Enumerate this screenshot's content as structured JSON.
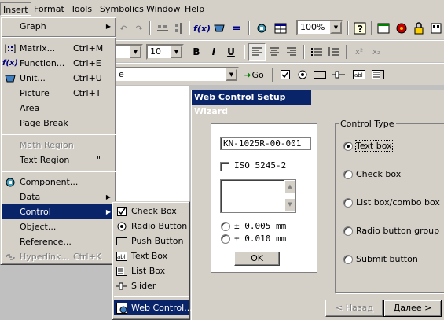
{
  "menubar": {
    "items": [
      "Insert",
      "Format",
      "Tools",
      "Symbolics",
      "Window",
      "Help"
    ]
  },
  "toolbar": {
    "zoom": "100%",
    "font_size": "10",
    "address_value": "e",
    "go_label": "Go"
  },
  "insert_menu": {
    "items": [
      {
        "label": "Graph",
        "shortcut": ""
      },
      {
        "label": "Matrix...",
        "shortcut": "Ctrl+M"
      },
      {
        "label": "Function...",
        "shortcut": "Ctrl+E"
      },
      {
        "label": "Unit...",
        "shortcut": "Ctrl+U"
      },
      {
        "label": "Picture",
        "shortcut": "Ctrl+T"
      },
      {
        "label": "Area",
        "shortcut": ""
      },
      {
        "label": "Page Break",
        "shortcut": ""
      },
      {
        "label": "Math Region",
        "shortcut": ""
      },
      {
        "label": "Text Region",
        "shortcut": "\""
      },
      {
        "label": "Component...",
        "shortcut": ""
      },
      {
        "label": "Data",
        "shortcut": ""
      },
      {
        "label": "Control",
        "shortcut": ""
      },
      {
        "label": "Object...",
        "shortcut": ""
      },
      {
        "label": "Reference...",
        "shortcut": ""
      },
      {
        "label": "Hyperlink...",
        "shortcut": "Ctrl+K"
      }
    ]
  },
  "control_submenu": {
    "items": [
      "Check Box",
      "Radio Button",
      "Push Button",
      "Text Box",
      "List Box",
      "Slider",
      "Web Control..."
    ]
  },
  "dialog": {
    "title": "Web Control Setup Wizard",
    "preview": {
      "textbox_value": "KN-1025R-00-001",
      "checkbox_label": "ISO 5245-2",
      "radio1_label": "± 0.005 mm",
      "radio2_label": "± 0.010 mm",
      "ok_label": "OK"
    },
    "group_title": "Control Type",
    "options": [
      "Text box",
      "Check box",
      "List box/combo box",
      "Radio button group",
      "Submit button"
    ],
    "back_label": "< Назад",
    "next_label": "Далее >"
  }
}
